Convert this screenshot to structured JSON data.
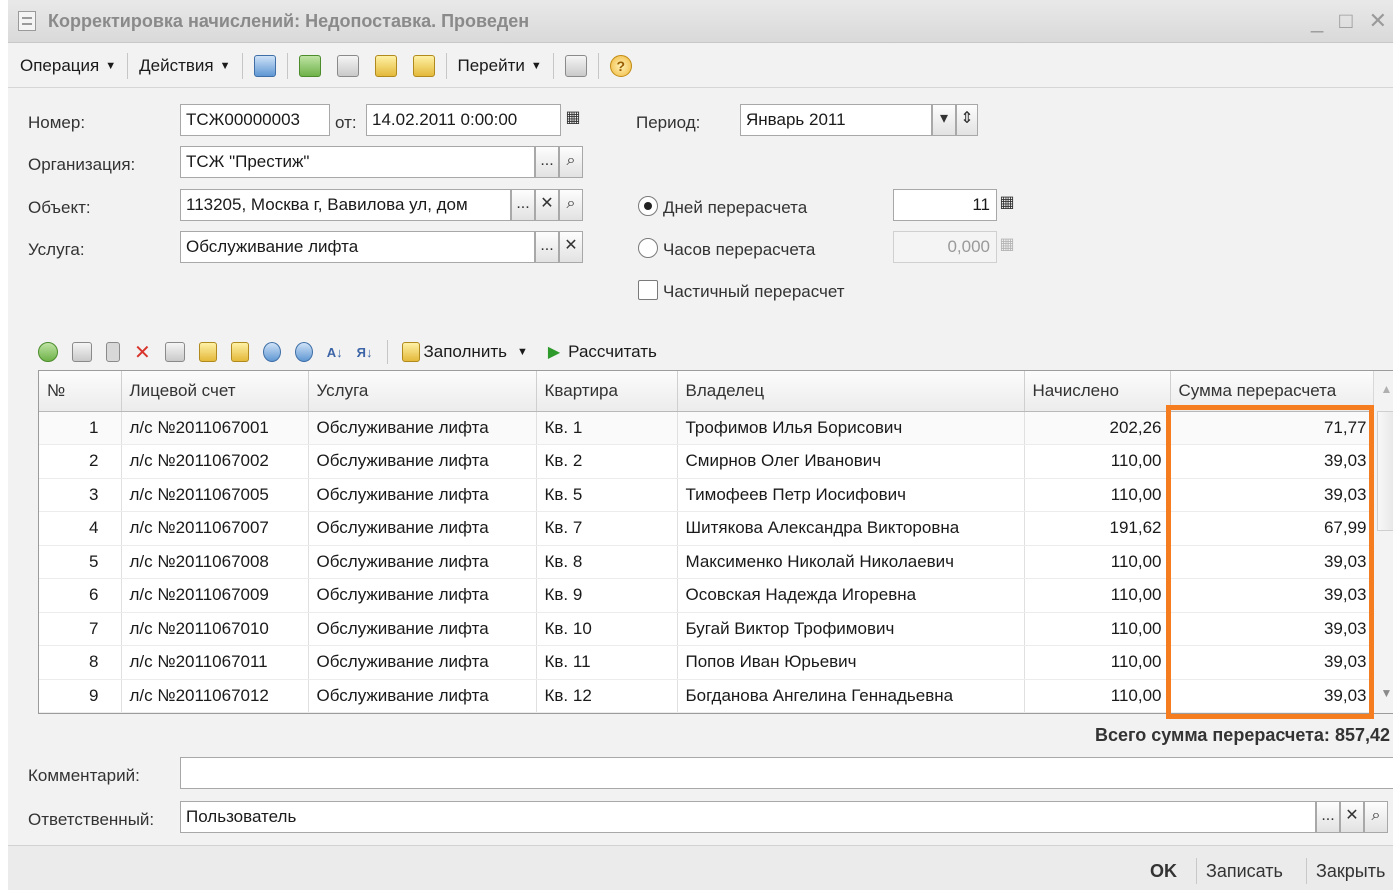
{
  "window": {
    "title": "Корректировка начислений: Недопоставка. Проведен",
    "min_glyph": "_",
    "max_glyph": "□",
    "close_glyph": "✕"
  },
  "toolbar": {
    "operation": "Операция",
    "actions": "Действия",
    "goto": "Перейти",
    "help_glyph": "?"
  },
  "form": {
    "number_label": "Номер:",
    "number_value": "ТСЖ00000003",
    "from_label": "от:",
    "date_value": "14.02.2011  0:00:00",
    "period_label": "Период:",
    "period_value": "Январь 2011",
    "org_label": "Организация:",
    "org_value": "ТСЖ \"Престиж\"",
    "object_label": "Объект:",
    "object_value": "113205, Москва г, Вавилова ул, дом",
    "service_label": "Услуга:",
    "service_value": "Обслуживание лифта",
    "days_label": "Дней перерасчета",
    "days_value": "11",
    "hours_label": "Часов перерасчета",
    "hours_value": "0,000",
    "partial_label": "Частичный перерасчет",
    "dots_glyph": "...",
    "clear_glyph": "✕",
    "search_glyph": "⌕",
    "dropdown_glyph": "▾",
    "spin_glyph": "⇕",
    "calendar_glyph": "▦",
    "calc_glyph": "▦",
    "mode": "days",
    "partial_checked": false
  },
  "table_toolbar": {
    "fill": "Заполнить",
    "calculate": "Рассчитать",
    "sort_asc_glyph": "А↓",
    "sort_desc_glyph": "Я↓"
  },
  "table": {
    "columns": [
      "№",
      "Лицевой счет",
      "Услуга",
      "Квартира",
      "Владелец",
      "Начислено",
      "Сумма перерасчета"
    ],
    "rows": [
      [
        "1",
        "л/с №2011067001",
        "Обслуживание лифта",
        "Кв. 1",
        "Трофимов Илья Борисович",
        "202,26",
        "71,77"
      ],
      [
        "2",
        "л/с №2011067002",
        "Обслуживание лифта",
        "Кв. 2",
        "Смирнов Олег Иванович",
        "110,00",
        "39,03"
      ],
      [
        "3",
        "л/с №2011067005",
        "Обслуживание лифта",
        "Кв. 5",
        "Тимофеев Петр Иосифович",
        "110,00",
        "39,03"
      ],
      [
        "4",
        "л/с №2011067007",
        "Обслуживание лифта",
        "Кв. 7",
        "Шитякова Александра Викторовна",
        "191,62",
        "67,99"
      ],
      [
        "5",
        "л/с №2011067008",
        "Обслуживание лифта",
        "Кв. 8",
        "Максименко Николай Николаевич",
        "110,00",
        "39,03"
      ],
      [
        "6",
        "л/с №2011067009",
        "Обслуживание лифта",
        "Кв. 9",
        "Осовская Надежда Игоревна",
        "110,00",
        "39,03"
      ],
      [
        "7",
        "л/с №2011067010",
        "Обслуживание лифта",
        "Кв. 10",
        "Бугай Виктор Трофимович",
        "110,00",
        "39,03"
      ],
      [
        "8",
        "л/с №2011067011",
        "Обслуживание лифта",
        "Кв. 11",
        "Попов Иван Юрьевич",
        "110,00",
        "39,03"
      ],
      [
        "9",
        "л/с №2011067012",
        "Обслуживание лифта",
        "Кв. 12",
        "Богданова Ангелина Геннадьевна",
        "110,00",
        "39,03"
      ]
    ],
    "scroll_up_glyph": "▲",
    "scroll_down_glyph": "▼"
  },
  "total": {
    "label": "Всего сумма перерасчета:",
    "value": "857,42"
  },
  "footer": {
    "comment_label": "Комментарий:",
    "comment_value": "",
    "responsible_label": "Ответственный:",
    "responsible_value": "Пользователь",
    "ok": "OK",
    "save": "Записать",
    "close": "Закрыть"
  },
  "colors": {
    "highlight": "#f57c1f"
  }
}
